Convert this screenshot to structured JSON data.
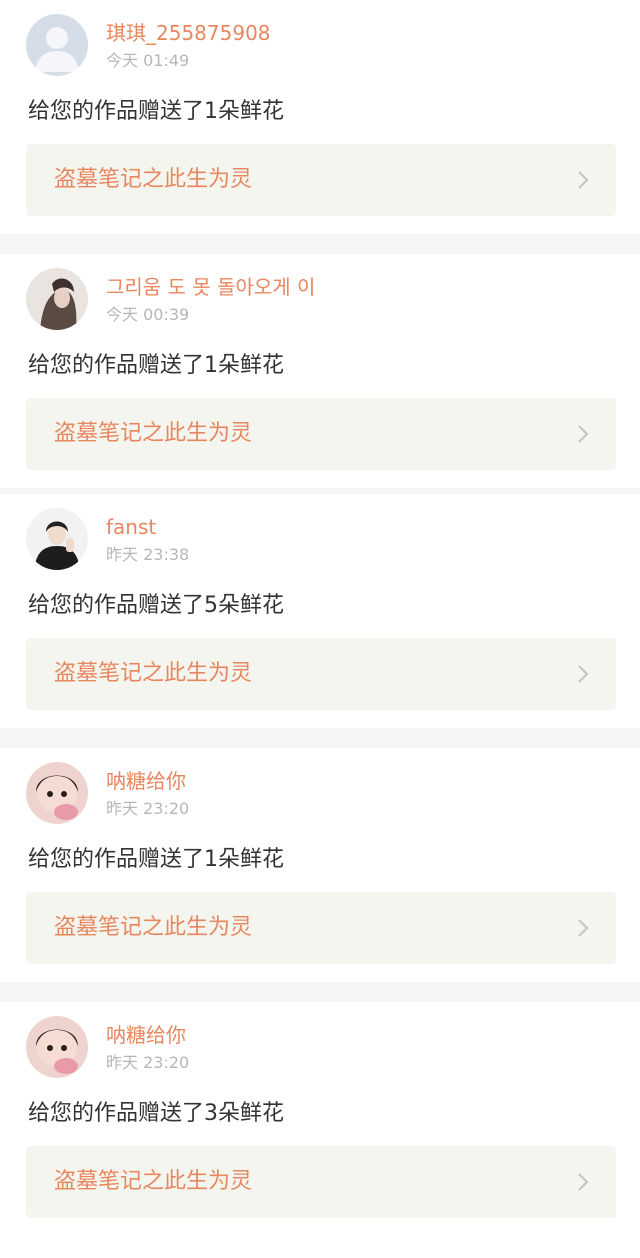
{
  "colors": {
    "accent": "#e8875f",
    "time": "#b7b7b7",
    "text": "#333333",
    "work_bg": "#f5f5ef",
    "gap": "#f5f5f5"
  },
  "notifications": [
    {
      "user": "琪琪_255875908",
      "time": "今天 01:49",
      "message": "给您的作品赠送了1朵鲜花",
      "work_title": "盗墓笔记之此生为灵",
      "avatar": "default-avatar-icon"
    },
    {
      "user": "그리움 도 못 돌아오게 이",
      "time": "今天 00:39",
      "message": "给您的作品赠送了1朵鲜花",
      "work_title": "盗墓笔记之此生为灵",
      "avatar": "girl-photo-avatar"
    },
    {
      "user": "fanst",
      "time": "昨天 23:38",
      "message": "给您的作品赠送了5朵鲜花",
      "work_title": "盗墓笔记之此生为灵",
      "avatar": "boy-photo-avatar"
    },
    {
      "user": "呐糖给你",
      "time": "昨天 23:20",
      "message": "给您的作品赠送了1朵鲜花",
      "work_title": "盗墓笔记之此生为灵",
      "avatar": "baby-photo-avatar"
    },
    {
      "user": "呐糖给你",
      "time": "昨天 23:20",
      "message": "给您的作品赠送了3朵鲜花",
      "work_title": "盗墓笔记之此生为灵",
      "avatar": "baby-photo-avatar"
    }
  ]
}
